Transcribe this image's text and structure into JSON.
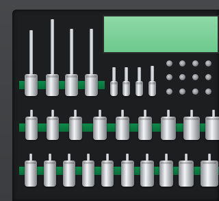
{
  "scene": {
    "subject": "socket-bit-tray",
    "tray_color": "#1d1e20",
    "stripe_color": "#0f8a4b",
    "label_color": "#7fd29c",
    "metal_color": "#d8dbde"
  }
}
